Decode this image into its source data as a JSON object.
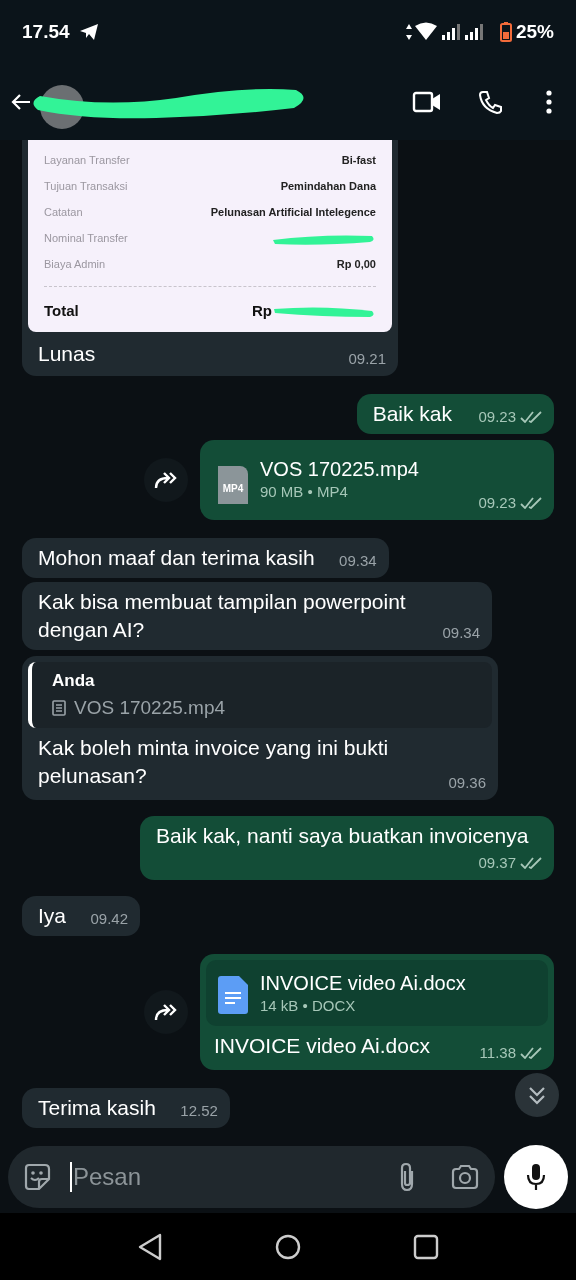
{
  "status_bar": {
    "time": "17.54",
    "battery": "25%",
    "battery_low": true
  },
  "header": {
    "name_redacted": true
  },
  "messages": [
    {
      "kind": "receipt",
      "outgoing": false,
      "rows": [
        {
          "label": "Layanan Transfer",
          "value": "Bi-fast"
        },
        {
          "label": "Tujuan Transaksi",
          "value": "Pemindahan Dana"
        },
        {
          "label": "Catatan",
          "value": "Pelunasan Artificial Intelegence"
        },
        {
          "label": "Nominal Transfer",
          "redacted": true
        },
        {
          "label": "Biaya Admin",
          "value": "Rp 0,00"
        }
      ],
      "total_label": "Total",
      "total_value": "Rp",
      "total_redacted": true,
      "text": "Lunas",
      "time": "09.21"
    },
    {
      "kind": "text",
      "outgoing": true,
      "text": "Baik kak",
      "time": "09.23",
      "read": false
    },
    {
      "kind": "video_file",
      "outgoing": true,
      "forward": true,
      "icon_label": "MP4",
      "file_name": "VOS 170225.mp4",
      "meta": "90 MB • MP4",
      "time": "09.23",
      "read": false
    },
    {
      "kind": "text",
      "outgoing": false,
      "text": "Mohon maaf dan terima kasih",
      "time": "09.34"
    },
    {
      "kind": "text",
      "outgoing": false,
      "text": "Kak bisa membuat tampilan powerpoint dengan AI?",
      "time": "09.34"
    },
    {
      "kind": "reply",
      "outgoing": false,
      "quote_author": "Anda",
      "quote_text": "VOS 170225.mp4",
      "text": "Kak boleh minta invoice yang ini bukti pelunasan?",
      "time": "09.36"
    },
    {
      "kind": "text",
      "outgoing": true,
      "text": "Baik kak, nanti saya buatkan invoicenya",
      "time": "09.37",
      "read": false
    },
    {
      "kind": "text",
      "outgoing": false,
      "text": "Iya",
      "time": "09.42"
    },
    {
      "kind": "document_file",
      "outgoing": true,
      "forward": true,
      "file_name": "INVOICE video Ai.docx",
      "meta": "14 kB • DOCX",
      "text": "INVOICE video Ai.docx",
      "time": "11.38",
      "read": false
    },
    {
      "kind": "text",
      "outgoing": false,
      "text": "Terima kasih",
      "time": "12.52"
    }
  ],
  "composer": {
    "placeholder": "Pesan"
  }
}
